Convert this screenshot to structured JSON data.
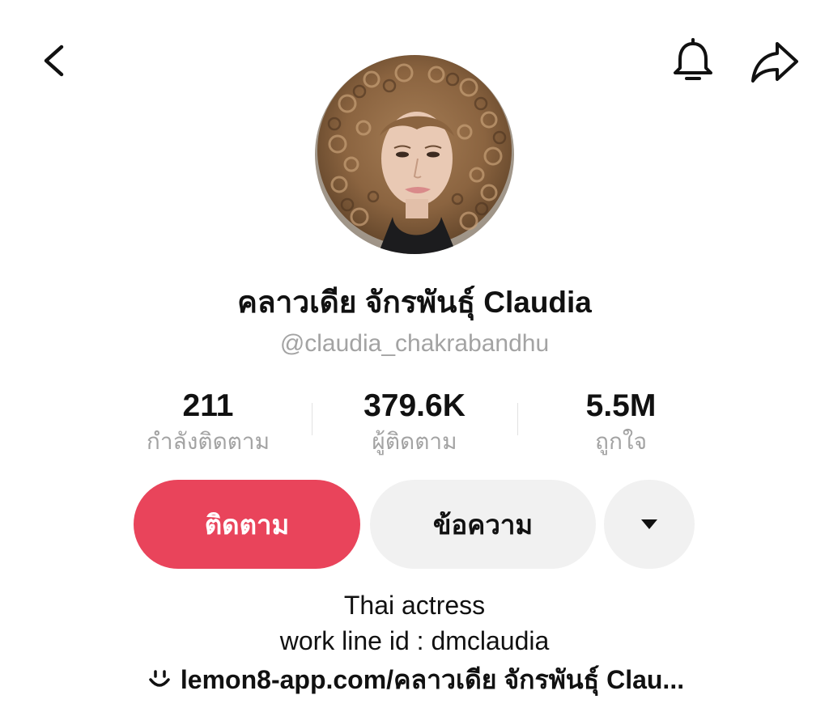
{
  "profile": {
    "display_name": "คลาวเดีย จักรพันธุ์ Claudia",
    "handle": "@claudia_chakrabandhu"
  },
  "stats": {
    "following": {
      "value": "211",
      "label": "กำลังติดตาม"
    },
    "followers": {
      "value": "379.6K",
      "label": "ผู้ติดตาม"
    },
    "likes": {
      "value": "5.5M",
      "label": "ถูกใจ"
    }
  },
  "actions": {
    "follow_label": "ติดตาม",
    "message_label": "ข้อความ"
  },
  "bio": {
    "line1": "Thai actress",
    "line2": "work line id : dmclaudia",
    "link": "lemon8-app.com/คลาวเดีย จักรพันธุ์ Clau..."
  },
  "icons": {
    "back": "chevron-left-icon",
    "notifications": "bell-icon",
    "share": "share-arrow-icon",
    "more": "caret-down-icon",
    "link": "lemon8-smile-icon"
  },
  "colors": {
    "accent": "#e9445b",
    "secondary_button": "#f1f1f1",
    "muted_text": "#a3a3a3"
  }
}
